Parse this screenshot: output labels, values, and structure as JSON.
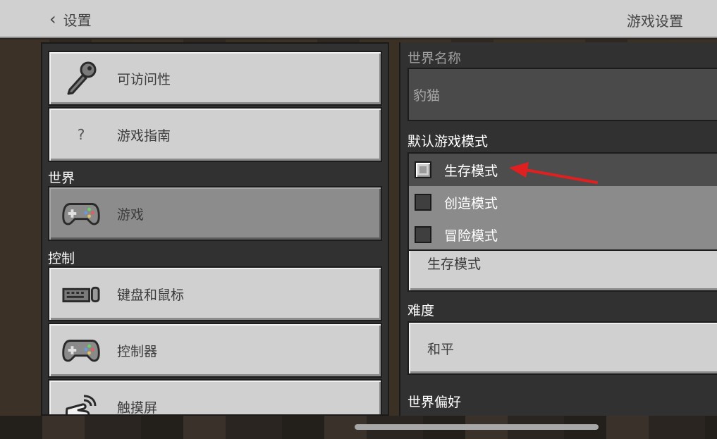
{
  "header": {
    "back_label": "设置",
    "title": "游戏设置"
  },
  "left": {
    "items_top": [
      {
        "label": "可访问性",
        "icon": "key-icon"
      },
      {
        "label": "游戏指南",
        "icon": "question-icon",
        "glyph": "?"
      }
    ],
    "section_world": "世界",
    "world_items": [
      {
        "label": "游戏",
        "icon": "gamepad-icon",
        "selected": true
      }
    ],
    "section_controls": "控制",
    "control_items": [
      {
        "label": "键盘和鼠标",
        "icon": "keyboard-mouse-icon"
      },
      {
        "label": "控制器",
        "icon": "gamepad-icon"
      },
      {
        "label": "触摸屏",
        "icon": "touch-icon"
      }
    ]
  },
  "right": {
    "world_name_label": "世界名称",
    "world_name_value": "豹猫",
    "default_mode_label": "默认游戏模式",
    "mode_options": [
      {
        "label": "生存模式",
        "checked": true
      },
      {
        "label": "创造模式",
        "checked": false
      },
      {
        "label": "冒险模式",
        "checked": false
      }
    ],
    "mode_selected_value": "生存模式",
    "difficulty_label": "难度",
    "difficulty_value": "和平",
    "world_pref_label": "世界偏好"
  },
  "colors": {
    "annotation_arrow": "#e02020",
    "panel_bg": "#313131",
    "button_bg": "#d0d0d0",
    "selected_bg": "#8c8c8c"
  }
}
